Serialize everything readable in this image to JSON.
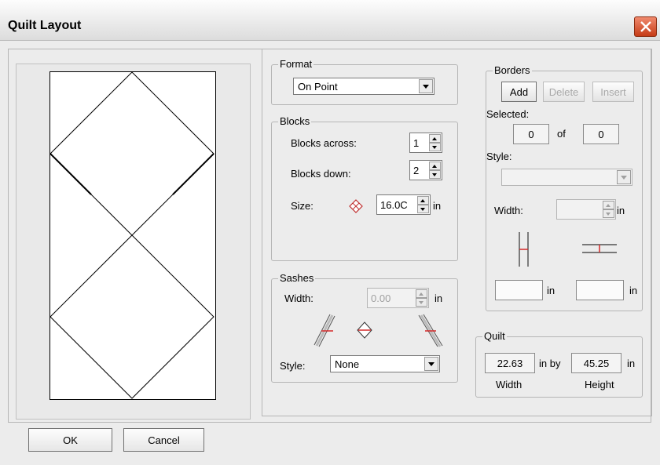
{
  "window": {
    "title": "Quilt Layout"
  },
  "format": {
    "legend": "Format",
    "value": "On Point"
  },
  "blocks": {
    "legend": "Blocks",
    "across_label": "Blocks across:",
    "across_value": "1",
    "down_label": "Blocks down:",
    "down_value": "2",
    "size_label": "Size:",
    "size_value": "16.0C",
    "size_unit": "in"
  },
  "sashes": {
    "legend": "Sashes",
    "width_label": "Width:",
    "width_value": "0.00",
    "width_unit": "in",
    "style_label": "Style:",
    "style_value": "None"
  },
  "borders": {
    "legend": "Borders",
    "add_label": "Add",
    "delete_label": "Delete",
    "insert_label": "Insert",
    "selected_label": "Selected:",
    "selected_value": "0",
    "of_label": "of",
    "total_value": "0",
    "style_label": "Style:",
    "style_value": "",
    "width_label": "Width:",
    "width_value": "",
    "width_unit": "in",
    "vertical_value": "",
    "vertical_unit": "in",
    "horizontal_value": "",
    "horizontal_unit": "in"
  },
  "quilt": {
    "legend": "Quilt",
    "width_value": "22.63",
    "by_label": "in by",
    "height_value": "45.25",
    "height_unit": "in",
    "width_caption": "Width",
    "height_caption": "Height"
  },
  "footer": {
    "ok_label": "OK",
    "cancel_label": "Cancel"
  },
  "colors": {
    "accent_red": "#d42a2a",
    "close_red": "#d4502c"
  },
  "icons": [
    "close-icon",
    "on-point-block-icon",
    "sash-left-icon",
    "sash-center-icon",
    "sash-right-icon",
    "border-vertical-icon",
    "border-horizontal-icon"
  ]
}
